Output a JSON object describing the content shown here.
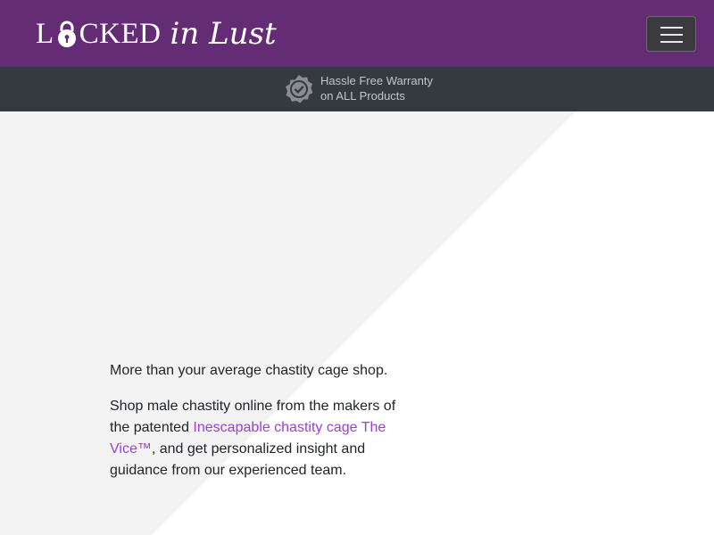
{
  "header": {
    "brand_main_before": "L",
    "brand_main_after": "CKED",
    "brand_script": "in Lust",
    "menu_icon": "hamburger-icon"
  },
  "colors": {
    "navbar": "#652c76",
    "promo_bar": "#343a40",
    "hero_shade": "#f3f3f3",
    "link": "#9b3fd6"
  },
  "promo": {
    "icon": "warranty-badge-icon",
    "line1": "Hassle Free Warranty",
    "line2": "on ALL Products"
  },
  "hero": {
    "tagline": "More than your average chastity cage shop.",
    "body_before": "Shop male chastity online from the makers of the patented ",
    "body_link": "Inescapable chastity cage The Vice™",
    "body_after": ", and get personalized insight and guidance from our experienced team."
  }
}
